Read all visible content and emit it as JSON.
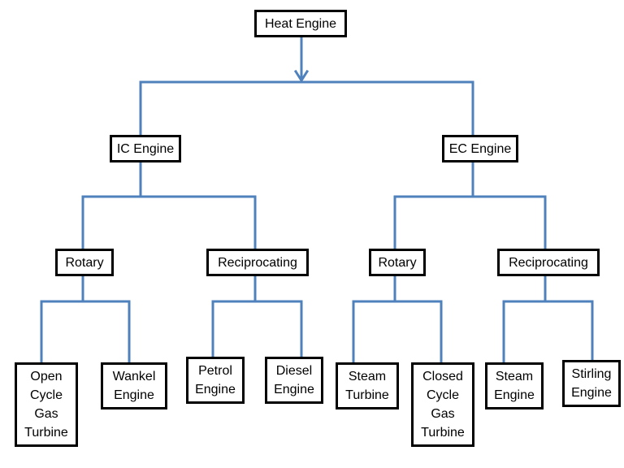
{
  "colors": {
    "connector": "#4f81bd",
    "box_border": "#000000",
    "text": "#000000",
    "background": "#ffffff"
  },
  "root": {
    "label": "Heat Engine"
  },
  "level1": [
    {
      "label": "IC Engine"
    },
    {
      "label": "EC Engine"
    }
  ],
  "level2": [
    {
      "label": "Rotary",
      "parent": "IC Engine"
    },
    {
      "label": "Reciprocating",
      "parent": "IC Engine"
    },
    {
      "label": "Rotary",
      "parent": "EC Engine"
    },
    {
      "label": "Reciprocating",
      "parent": "EC Engine"
    }
  ],
  "level3": [
    {
      "label": "Open\nCycle\nGas\nTurbine",
      "parent": "IC Engine / Rotary"
    },
    {
      "label": "Wankel\nEngine",
      "parent": "IC Engine / Rotary"
    },
    {
      "label": "Petrol\nEngine",
      "parent": "IC Engine / Reciprocating"
    },
    {
      "label": "Diesel\nEngine",
      "parent": "IC Engine / Reciprocating"
    },
    {
      "label": "Steam\nTurbine",
      "parent": "EC Engine / Rotary"
    },
    {
      "label": "Closed\nCycle\nGas\nTurbine",
      "parent": "EC Engine / Rotary"
    },
    {
      "label": "Steam\nEngine",
      "parent": "EC Engine / Reciprocating"
    },
    {
      "label": "Stirling\nEngine",
      "parent": "EC Engine / Reciprocating"
    }
  ]
}
